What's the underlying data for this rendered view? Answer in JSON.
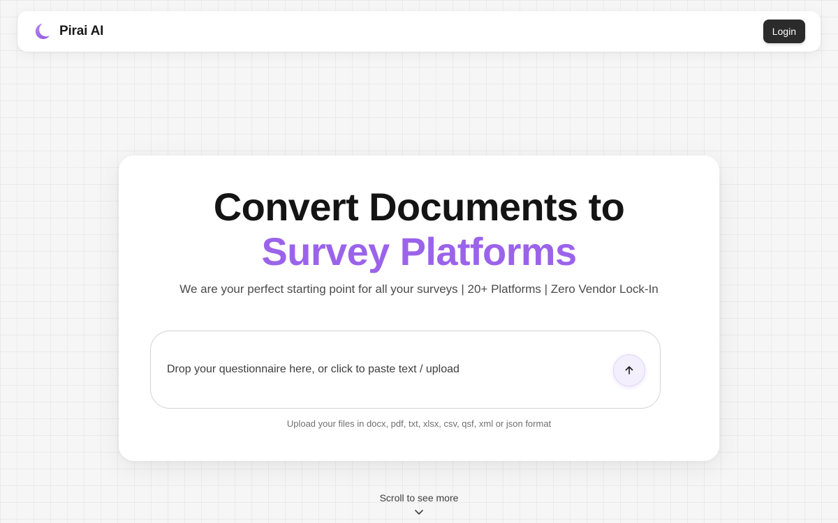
{
  "navbar": {
    "brand_name": "Pirai AI",
    "brand_icon": "moon-icon",
    "login_label": "Login"
  },
  "hero": {
    "title_line1": "Convert Documents to",
    "title_line2": "Survey Platforms",
    "subtitle": "We are your perfect starting point for all your surveys | 20+ Platforms | Zero Vendor Lock-In",
    "accent_color": "#9b63ea"
  },
  "upload": {
    "drop_text": "Drop your questionnaire here, or click to paste text / upload",
    "button_icon": "arrow-up-icon",
    "formats_note": "Upload your files in docx, pdf, txt, xlsx, csv, qsf, xml or json format"
  },
  "footer": {
    "scroll_hint": "Scroll to see more",
    "scroll_icon": "chevron-down-icon"
  }
}
